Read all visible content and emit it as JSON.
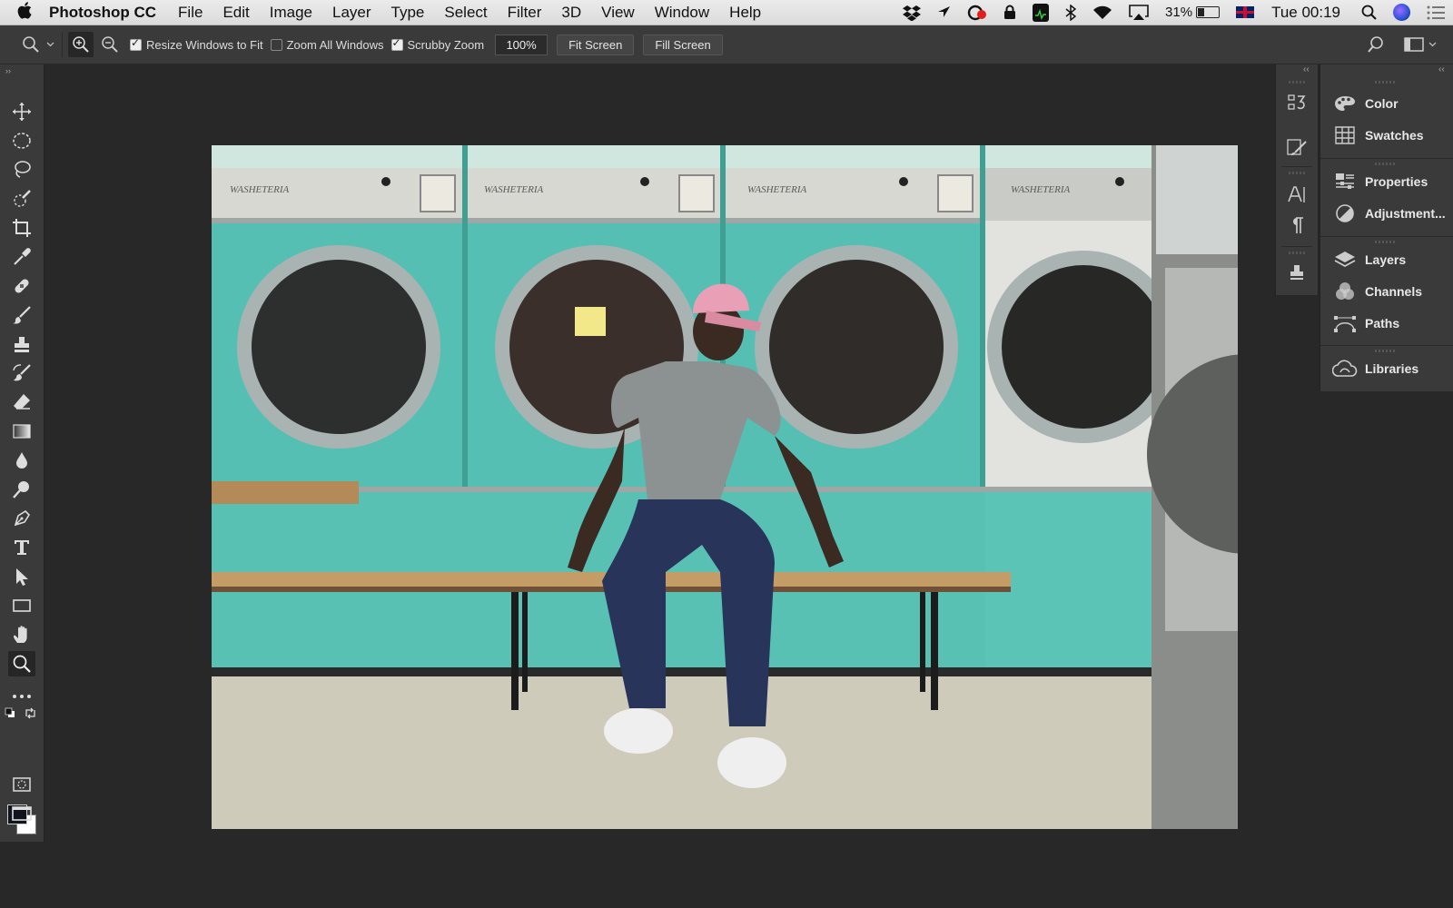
{
  "menubar": {
    "app_name": "Photoshop CC",
    "items": [
      "File",
      "Edit",
      "Image",
      "Layer",
      "Type",
      "Select",
      "Filter",
      "3D",
      "View",
      "Window",
      "Help"
    ],
    "battery": "31%",
    "clock": "Tue 00:19"
  },
  "options": {
    "resize_windows_label": "Resize Windows to Fit",
    "resize_windows_checked": true,
    "zoom_all_label": "Zoom All Windows",
    "zoom_all_checked": false,
    "scrubby_label": "Scrubby Zoom",
    "scrubby_checked": true,
    "zoom_value": "100%",
    "fit_screen": "Fit Screen",
    "fill_screen": "Fill Screen"
  },
  "tools": [
    "move-tool",
    "marquee-tool",
    "lasso-tool",
    "quick-selection-tool",
    "crop-tool",
    "eyedropper-tool",
    "healing-brush-tool",
    "brush-tool",
    "clone-stamp-tool",
    "history-brush-tool",
    "eraser-tool",
    "gradient-tool",
    "blur-tool",
    "dodge-tool",
    "pen-tool",
    "type-tool",
    "path-selection-tool",
    "rectangle-tool",
    "hand-tool",
    "zoom-tool",
    "edit-toolbar"
  ],
  "colors": {
    "foreground": "#10141c",
    "background": "#ffffff",
    "ui_panel": "#3a3a3a",
    "canvas_bg": "#282828"
  },
  "panels": {
    "color": "Color",
    "swatches": "Swatches",
    "properties": "Properties",
    "adjustments": "Adjustment...",
    "layers": "Layers",
    "channels": "Channels",
    "paths": "Paths",
    "libraries": "Libraries"
  },
  "document": {
    "image_subject": "man-in-pink-cap-sitting-on-bench-in-laundromat",
    "washer_labels": [
      "WASHETERIA",
      "WASHETERIA",
      "WASHETERIA",
      "WASHETERIA"
    ]
  }
}
